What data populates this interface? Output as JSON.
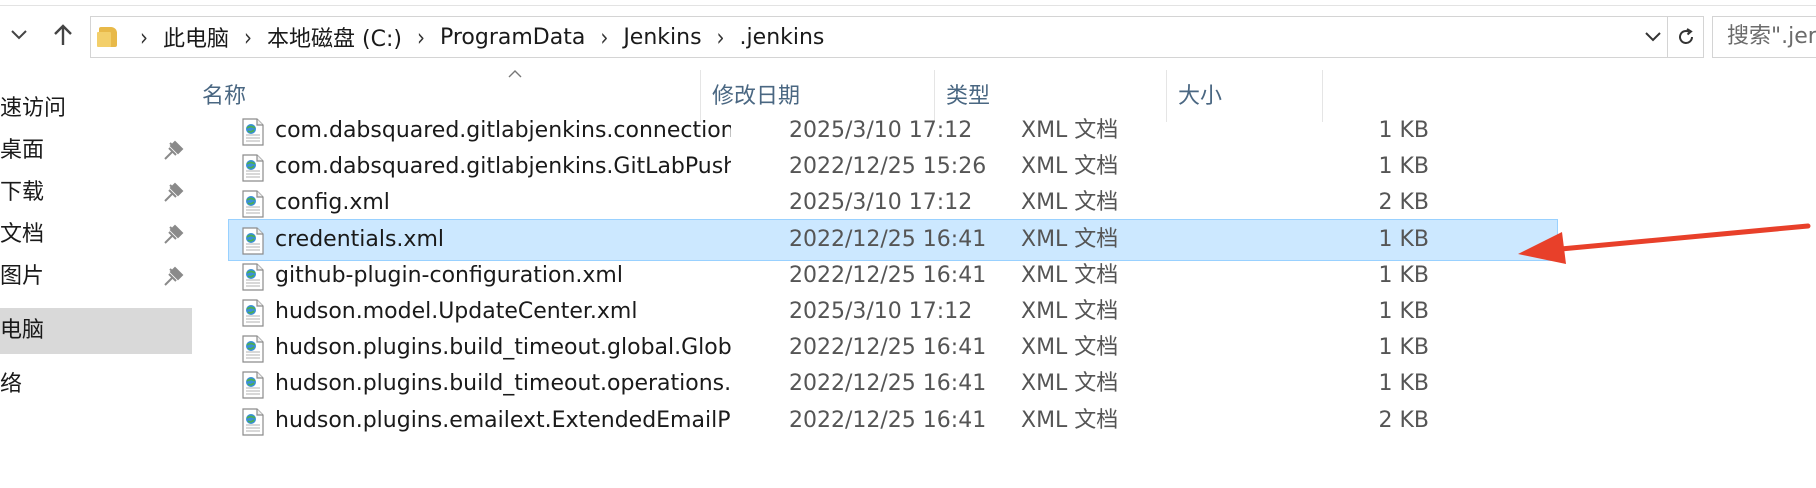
{
  "address_bar": {
    "breadcrumbs": [
      "此电脑",
      "本地磁盘 (C:)",
      "ProgramData",
      "Jenkins",
      ".jenkins"
    ],
    "search_placeholder": "搜索\".jer"
  },
  "nav_pane": {
    "items": [
      {
        "label": "速访问",
        "pinned": false,
        "selected": false
      },
      {
        "label": "桌面",
        "pinned": true,
        "selected": false
      },
      {
        "label": "下载",
        "pinned": true,
        "selected": false
      },
      {
        "label": "文档",
        "pinned": true,
        "selected": false
      },
      {
        "label": "图片",
        "pinned": true,
        "selected": false
      },
      {
        "label": "电脑",
        "pinned": false,
        "selected": true
      },
      {
        "label": "络",
        "pinned": false,
        "selected": false
      }
    ]
  },
  "file_list": {
    "columns": {
      "name": "名称",
      "date": "修改日期",
      "type": "类型",
      "size": "大小"
    },
    "rows": [
      {
        "name": "com.dabsquared.gitlabjenkins.connection.G...",
        "date": "2025/3/10 17:12",
        "type": "XML 文档",
        "size": "1 KB",
        "selected": false
      },
      {
        "name": "com.dabsquared.gitlabjenkins.GitLabPushTr...",
        "date": "2022/12/25 15:26",
        "type": "XML 文档",
        "size": "1 KB",
        "selected": false
      },
      {
        "name": "config.xml",
        "date": "2025/3/10 17:12",
        "type": "XML 文档",
        "size": "2 KB",
        "selected": false
      },
      {
        "name": "credentials.xml",
        "date": "2022/12/25 16:41",
        "type": "XML 文档",
        "size": "1 KB",
        "selected": true
      },
      {
        "name": "github-plugin-configuration.xml",
        "date": "2022/12/25 16:41",
        "type": "XML 文档",
        "size": "1 KB",
        "selected": false
      },
      {
        "name": "hudson.model.UpdateCenter.xml",
        "date": "2025/3/10 17:12",
        "type": "XML 文档",
        "size": "1 KB",
        "selected": false
      },
      {
        "name": "hudson.plugins.build_timeout.global.Global...",
        "date": "2022/12/25 16:41",
        "type": "XML 文档",
        "size": "1 KB",
        "selected": false
      },
      {
        "name": "hudson.plugins.build_timeout.operations.B...",
        "date": "2022/12/25 16:41",
        "type": "XML 文档",
        "size": "1 KB",
        "selected": false
      },
      {
        "name": "hudson.plugins.emailext.ExtendedEmailPubl...",
        "date": "2022/12/25 16:41",
        "type": "XML 文档",
        "size": "2 KB",
        "selected": false
      }
    ]
  },
  "colors": {
    "selection_bg": "#cce8ff",
    "selection_border": "#99d1ff",
    "header_text": "#4a6782",
    "annotation_arrow": "#e8402a"
  }
}
